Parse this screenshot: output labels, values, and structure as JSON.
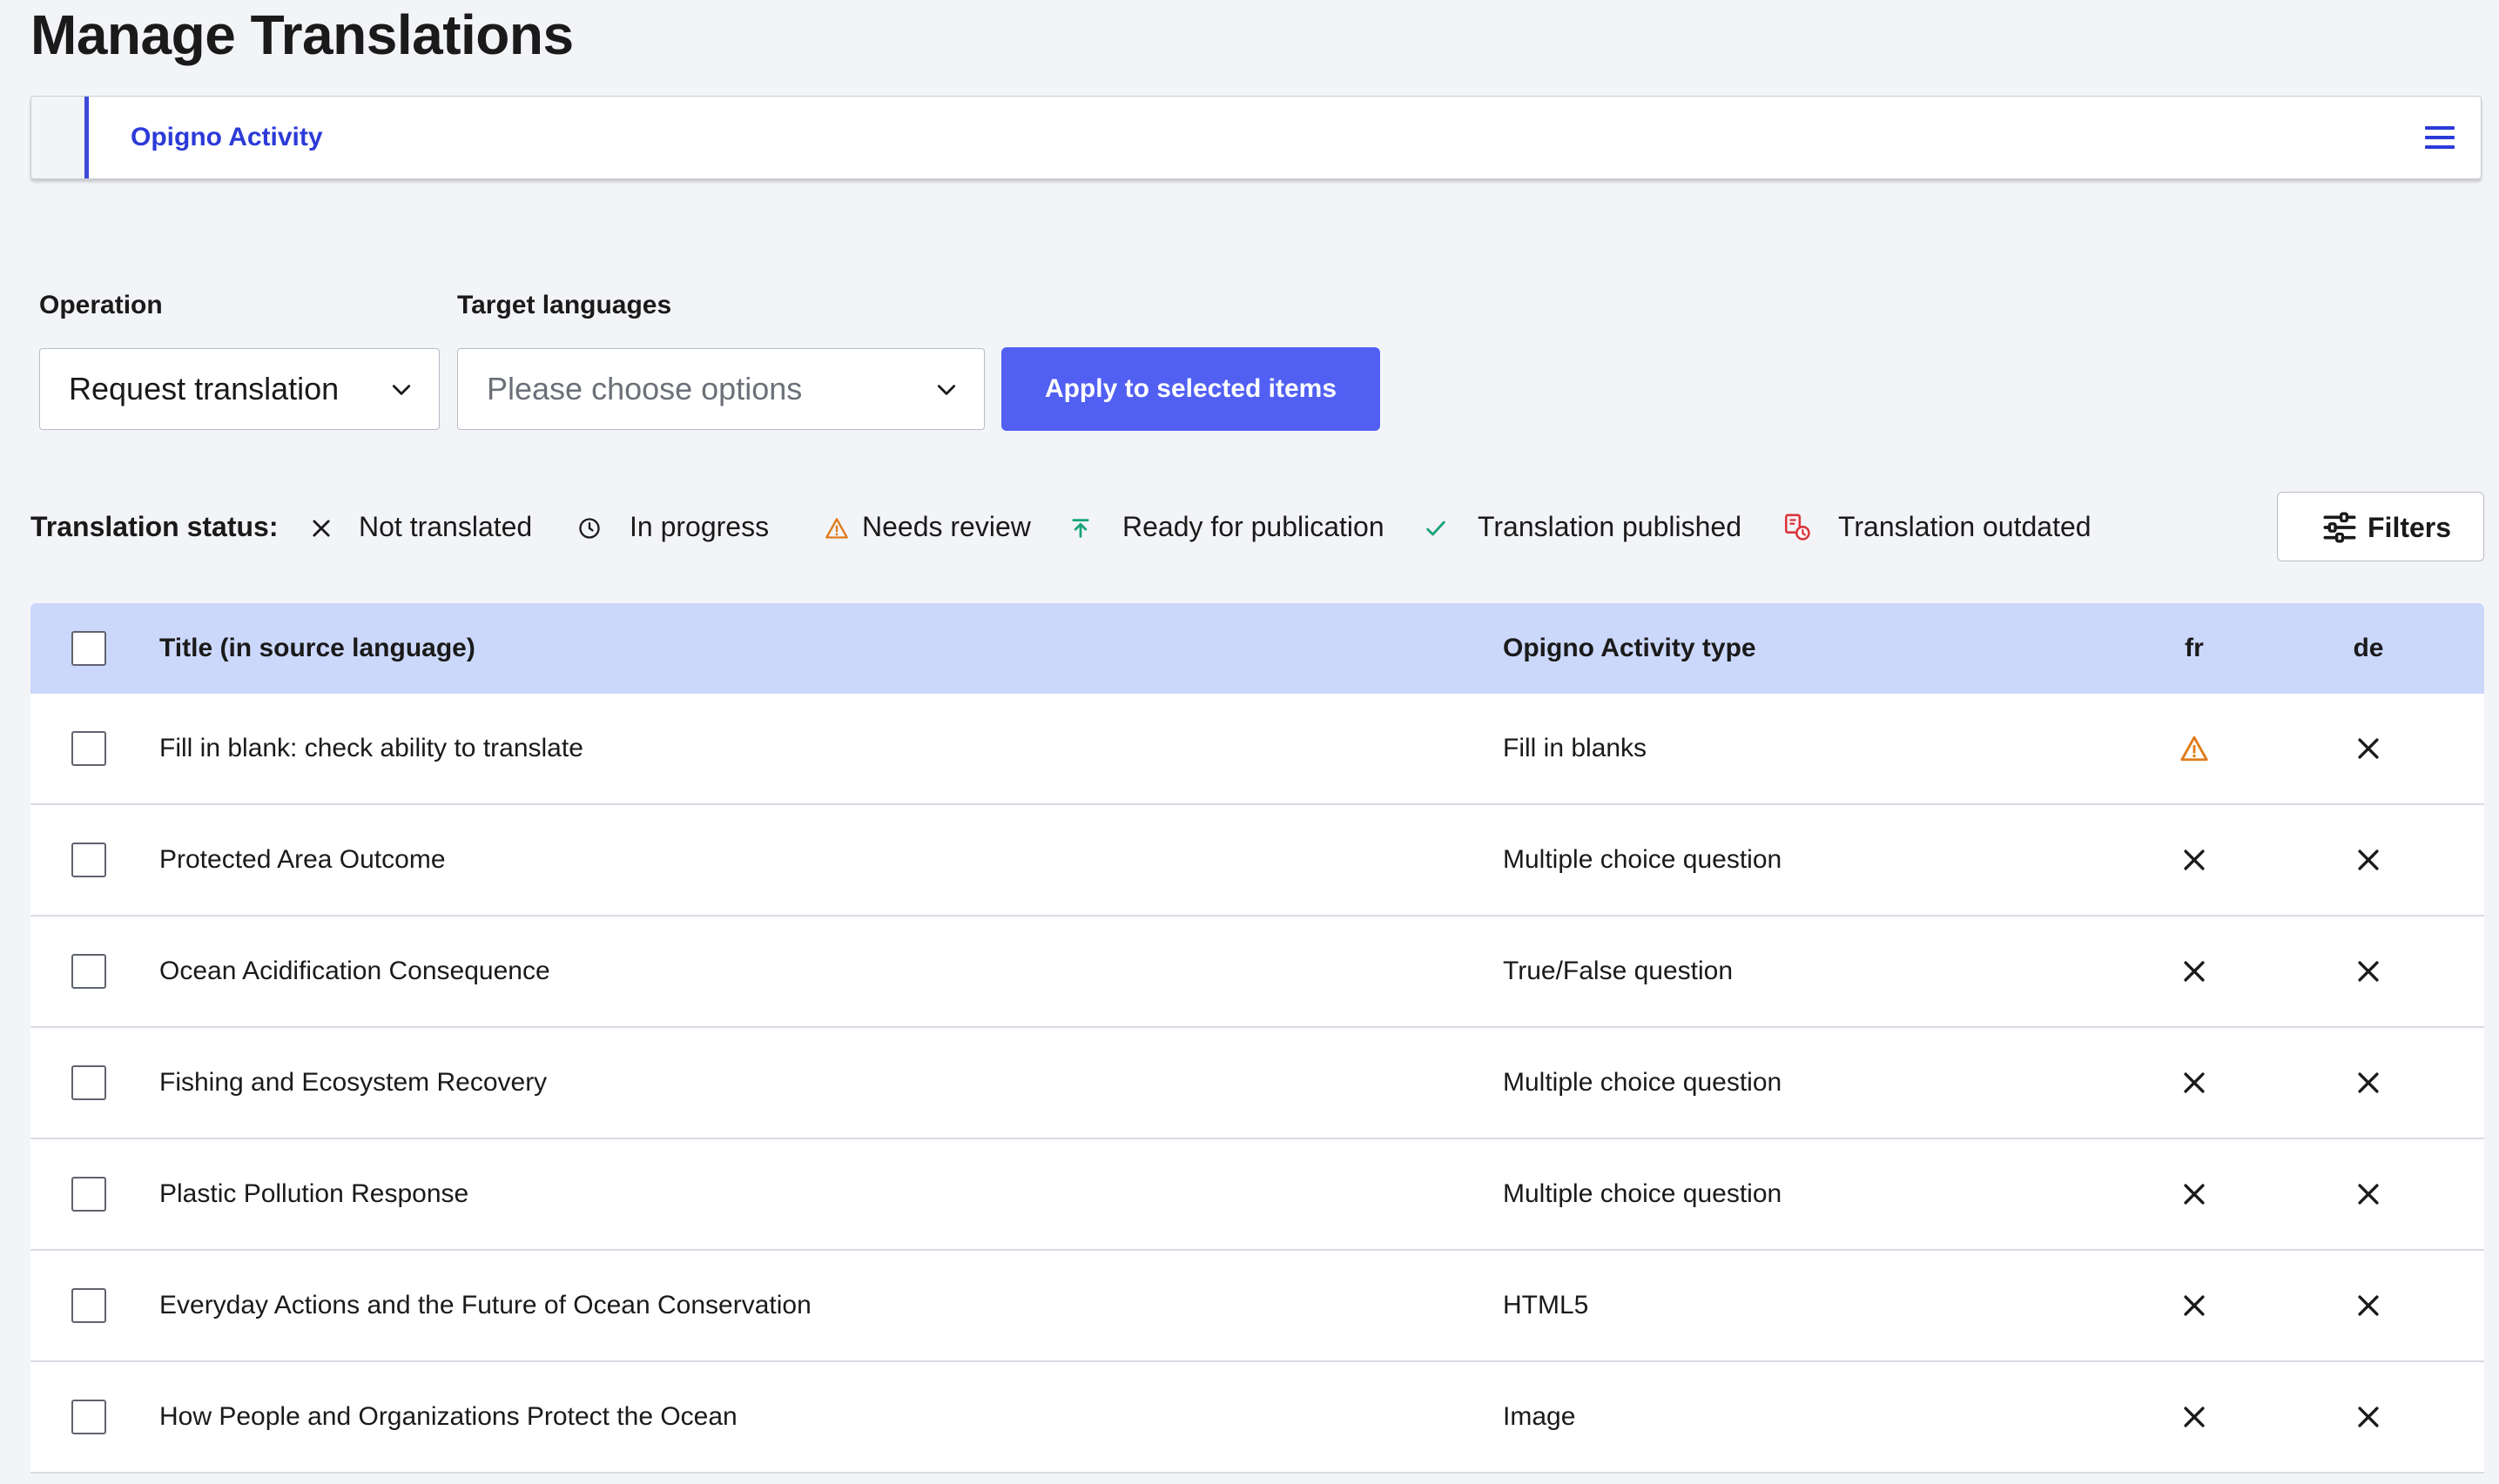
{
  "page": {
    "title": "Manage Translations"
  },
  "tabbar": {
    "active_tab": "Opigno Activity",
    "menu_icon": "hamburger-menu-icon"
  },
  "form": {
    "operation_label": "Operation",
    "operation_value": "Request translation",
    "target_label": "Target languages",
    "target_placeholder": "Please choose options",
    "apply_label": "Apply to selected items"
  },
  "legend": {
    "title": "Translation status:",
    "items": [
      {
        "label": "Not translated",
        "icon": "x-icon",
        "color": "#1a1a1a"
      },
      {
        "label": "In progress",
        "icon": "clock-icon",
        "color": "#1a1a1a"
      },
      {
        "label": "Needs review",
        "icon": "warning-icon",
        "color": "#e07b1a"
      },
      {
        "label": "Ready for publication",
        "icon": "upload-arrow-icon",
        "color": "#1aa37a"
      },
      {
        "label": "Translation published",
        "icon": "check-icon",
        "color": "#1aa37a"
      },
      {
        "label": "Translation outdated",
        "icon": "outdated-doc-icon",
        "color": "#d9343a"
      }
    ]
  },
  "filters": {
    "label": "Filters",
    "icon": "sliders-icon"
  },
  "table": {
    "headers": {
      "title": "Title (in source language)",
      "type": "Opigno Activity type",
      "fr": "fr",
      "de": "de"
    },
    "rows": [
      {
        "title": "Fill in blank: check ability to translate",
        "type": "Fill in blanks",
        "fr": "warning",
        "de": "x"
      },
      {
        "title": "Protected Area Outcome",
        "type": "Multiple choice question",
        "fr": "x",
        "de": "x"
      },
      {
        "title": "Ocean Acidification Consequence",
        "type": "True/False question",
        "fr": "x",
        "de": "x"
      },
      {
        "title": "Fishing and Ecosystem Recovery",
        "type": "Multiple choice question",
        "fr": "x",
        "de": "x"
      },
      {
        "title": "Plastic Pollution Response",
        "type": "Multiple choice question",
        "fr": "x",
        "de": "x"
      },
      {
        "title": "Everyday Actions and the Future of Ocean Conservation",
        "type": "HTML5",
        "fr": "x",
        "de": "x"
      },
      {
        "title": "How People and Organizations Protect the Ocean",
        "type": "Image",
        "fr": "x",
        "de": "x"
      }
    ]
  },
  "colors": {
    "accent": "#5160f3",
    "tab_text": "#2c3ad8",
    "header_bg": "#ccd8fb",
    "page_bg": "#f3f4f7"
  }
}
